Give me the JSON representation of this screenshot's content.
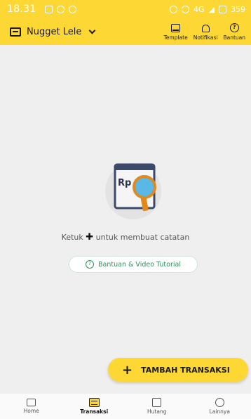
{
  "status_bar": {
    "time": "18.31",
    "right_text": "4G",
    "battery": "359"
  },
  "toolbar": {
    "store_name": "Nugget Lele",
    "actions": [
      {
        "label": "Template",
        "icon": "template-icon"
      },
      {
        "label": "Notifikasi",
        "icon": "bell-icon"
      },
      {
        "label": "Bantuan",
        "icon": "help-icon"
      }
    ]
  },
  "empty_state": {
    "text_before": "Ketuk",
    "text_after": "untuk membuat catatan",
    "illustration_label": "Rp",
    "help_chip_label": "Bantuan & Video Tutorial"
  },
  "fab": {
    "label": "TAMBAH TRANSAKSI"
  },
  "bottom_nav": {
    "items": [
      {
        "label": "Home",
        "icon": "home-icon"
      },
      {
        "label": "Transaksi",
        "icon": "transaction-icon"
      },
      {
        "label": "Hutang",
        "icon": "debt-icon"
      },
      {
        "label": "Lainnya",
        "icon": "more-icon"
      }
    ],
    "active": "Transaksi"
  },
  "colors": {
    "primary_yellow": "#fdd835",
    "background": "#efefef",
    "accent_green": "#2f8f5b",
    "illustration_orange": "#e08a1e",
    "illustration_blue": "#5ab8e6"
  }
}
